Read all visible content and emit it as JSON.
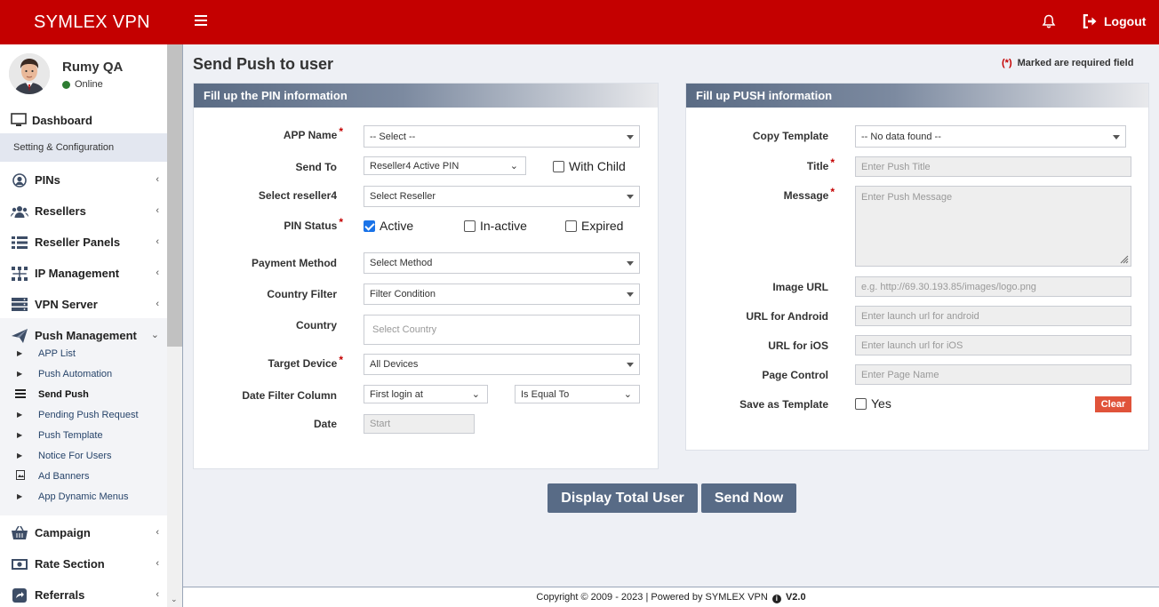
{
  "brand": "SYMLEX VPN",
  "topbar": {
    "logout_label": "Logout"
  },
  "user": {
    "name": "Rumy QA",
    "status": "Online"
  },
  "sidebar": {
    "dashboard": "Dashboard",
    "section": "Setting & Configuration",
    "items": [
      {
        "label": "PINs",
        "icon": "user-circle-icon"
      },
      {
        "label": "Resellers",
        "icon": "users-icon"
      },
      {
        "label": "Reseller Panels",
        "icon": "list-icon"
      },
      {
        "label": "IP Management",
        "icon": "network-icon"
      },
      {
        "label": "VPN Server",
        "icon": "server-icon"
      },
      {
        "label": "Push Management",
        "icon": "paper-plane-icon"
      },
      {
        "label": "Campaign",
        "icon": "basket-icon"
      },
      {
        "label": "Rate Section",
        "icon": "money-icon"
      },
      {
        "label": "Referrals",
        "icon": "share-icon"
      }
    ],
    "push_sub": [
      "APP List",
      "Push Automation",
      "Send Push",
      "Pending Push Request",
      "Push Template",
      "Notice For Users",
      "Ad Banners",
      "App Dynamic Menus"
    ]
  },
  "page": {
    "title": "Send Push to user",
    "required_star": "(*)",
    "required_note": "Marked are required field"
  },
  "pin_panel": {
    "heading": "Fill up the PIN information",
    "app_name_label": "APP Name",
    "app_name_value": "-- Select --",
    "send_to_label": "Send To",
    "send_to_value": "Reseller4 Active PIN",
    "with_child_label": "With Child",
    "reseller_label": "Select reseller4",
    "reseller_value": "Select Reseller",
    "pin_status_label": "PIN Status",
    "status_active": "Active",
    "status_inactive": "In-active",
    "status_expired": "Expired",
    "payment_label": "Payment Method",
    "payment_value": "Select Method",
    "country_filter_label": "Country Filter",
    "country_filter_value": "Filter Condition",
    "country_label": "Country",
    "country_placeholder": "Select Country",
    "target_label": "Target Device",
    "target_value": "All Devices",
    "date_col_label": "Date Filter Column",
    "date_col_value": "First login at",
    "date_cond_value": "Is Equal To",
    "date_label": "Date",
    "date_placeholder": "Start"
  },
  "push_panel": {
    "heading": "Fill up PUSH information",
    "copy_label": "Copy Template",
    "copy_value": "-- No data found --",
    "title_label": "Title",
    "title_placeholder": "Enter Push Title",
    "message_label": "Message",
    "message_placeholder": "Enter Push Message",
    "image_label": "Image URL",
    "image_placeholder": "e.g. http://69.30.193.85/images/logo.png",
    "android_label": "URL for Android",
    "android_placeholder": "Enter launch url for android",
    "ios_label": "URL for iOS",
    "ios_placeholder": "Enter launch url for iOS",
    "page_label": "Page Control",
    "page_placeholder": "Enter Page Name",
    "save_label": "Save as Template",
    "save_yes": "Yes",
    "clear_label": "Clear"
  },
  "actions": {
    "display_total": "Display Total User",
    "send_now": "Send Now"
  },
  "footer": {
    "text": "Copyright © 2009 - 2023 | Powered by SYMLEX VPN",
    "version": "V2.0"
  },
  "colors": {
    "brand_red": "#c40000",
    "button": "#586b86",
    "clear": "#e0533a"
  }
}
